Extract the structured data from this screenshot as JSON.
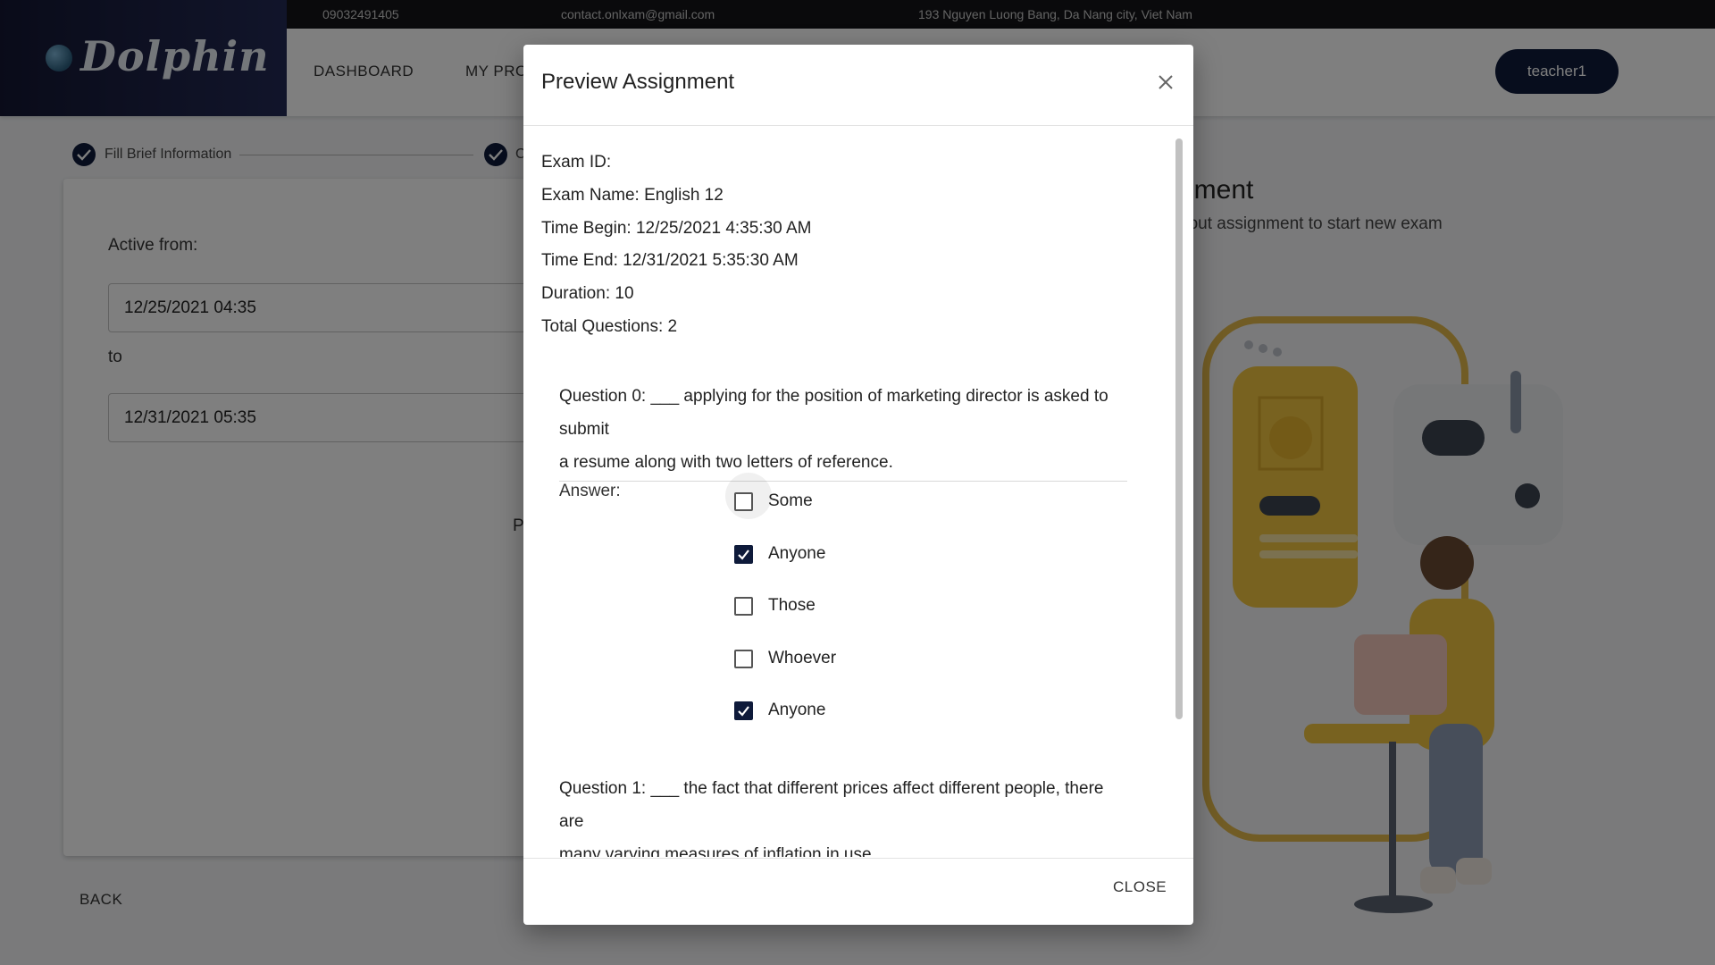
{
  "topbar": {
    "phone": "09032491405",
    "email": "contact.onlxam@gmail.com",
    "address": "193 Nguyen Luong Bang, Da Nang city, Viet Nam"
  },
  "header": {
    "logo": "Dolphin",
    "nav": [
      "DASHBOARD",
      "MY PRO"
    ],
    "user": "teacher1"
  },
  "stepper": {
    "step1": "Fill Brief Information",
    "step2": "C"
  },
  "form": {
    "active_from_label": "Active from:",
    "active_from_value": "12/25/2021 04:35",
    "to_label": "to",
    "to_value": "12/31/2021 05:35",
    "partial_text": "P",
    "back": "BACK"
  },
  "background": {
    "title": "nment",
    "subtitle": "bout assignment to start new exam"
  },
  "dialog": {
    "title": "Preview Assignment",
    "close_label": "CLOSE",
    "info": [
      "Exam ID:",
      "Exam Name: English 12",
      "Time Begin: 12/25/2021 4:35:30 AM",
      "Time End: 12/31/2021 5:35:30 AM",
      "Duration: 10",
      "Total Questions: 2"
    ],
    "answer_label": "Answer:",
    "questions": [
      {
        "line1": "Question 0: ___ applying for the position of marketing director is asked to submit",
        "line2": "a resume along with two letters of reference.",
        "options": [
          {
            "label": "Some",
            "checked": false
          },
          {
            "label": "Anyone",
            "checked": true
          },
          {
            "label": "Those",
            "checked": false
          },
          {
            "label": "Whoever",
            "checked": false
          },
          {
            "label": "Anyone",
            "checked": true
          }
        ]
      },
      {
        "line1": "Question 1: ___ the fact that different prices affect different people, there are",
        "line2": "many varying measures of inflation in use."
      }
    ]
  },
  "colors": {
    "primary": "#0e1a3a",
    "overlay": "rgba(0,0,0,0.5)"
  }
}
